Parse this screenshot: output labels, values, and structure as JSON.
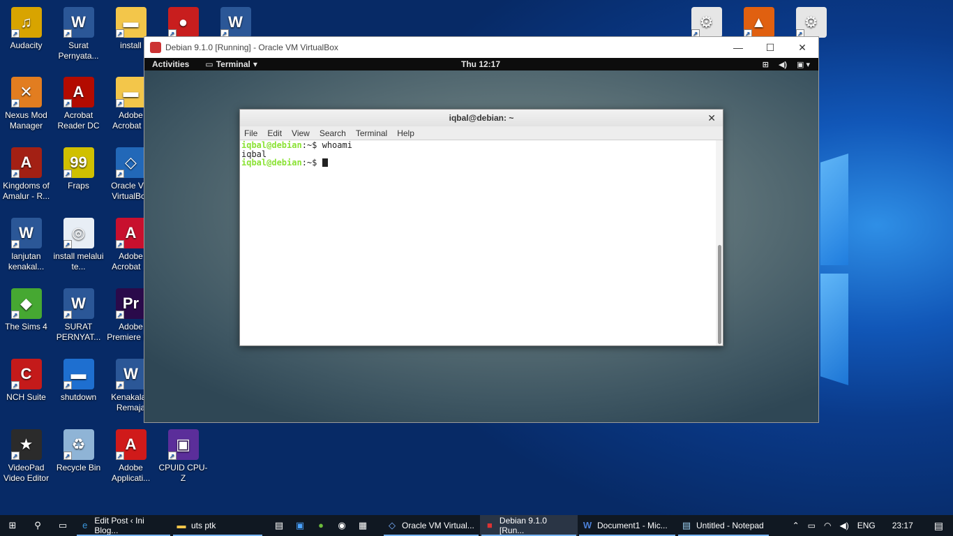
{
  "desktop_icons": [
    {
      "label": "Audacity",
      "glyph": "♫",
      "color": "#d8a400"
    },
    {
      "label": "Surat Pernyata...",
      "glyph": "W",
      "color": "#2b5797"
    },
    {
      "label": "install",
      "glyph": "▬",
      "color": "#f3c64a"
    },
    {
      "label": "",
      "glyph": "●",
      "color": "#c81e1e"
    },
    {
      "label": "",
      "glyph": "W",
      "color": "#2b5797"
    },
    {
      "label": "Nexus Mod Manager",
      "glyph": "✕",
      "color": "#e27d20"
    },
    {
      "label": "Acrobat Reader DC",
      "glyph": "A",
      "color": "#b30b00"
    },
    {
      "label": "Adobe Acrobat X",
      "glyph": "▬",
      "color": "#f3c64a"
    },
    {
      "label": "Kingdoms of Amalur - R...",
      "glyph": "A",
      "color": "#a32014"
    },
    {
      "label": "Fraps",
      "glyph": "99",
      "color": "#d0c000"
    },
    {
      "label": "Oracle VM VirtualBox",
      "glyph": "◇",
      "color": "#2268b8"
    },
    {
      "label": "lanjutan kenakal...",
      "glyph": "W",
      "color": "#2b5797"
    },
    {
      "label": "install melalui te...",
      "glyph": "◎",
      "color": "#e8eef5"
    },
    {
      "label": "Adobe Acrobat ...",
      "glyph": "A",
      "color": "#c8102e"
    },
    {
      "label": "The Sims 4",
      "glyph": "◆",
      "color": "#46a832"
    },
    {
      "label": "SURAT PERNYAT...",
      "glyph": "W",
      "color": "#2b5797"
    },
    {
      "label": "Adobe Premiere P...",
      "glyph": "Pr",
      "color": "#2a0a4a"
    },
    {
      "label": "NCH Suite",
      "glyph": "C",
      "color": "#c41a1a"
    },
    {
      "label": "shutdown",
      "glyph": "▬",
      "color": "#1e6fd0"
    },
    {
      "label": "Kenakalan Remaja",
      "glyph": "W",
      "color": "#2b5797"
    },
    {
      "label": "VideoPad Video Editor",
      "glyph": "★",
      "color": "#2b2b2b"
    },
    {
      "label": "Recycle Bin",
      "glyph": "♻",
      "color": "#8fb4d6"
    },
    {
      "label": "Adobe Applicati...",
      "glyph": "A",
      "color": "#d01a1a"
    },
    {
      "label": "CPUID CPU-Z",
      "glyph": "▣",
      "color": "#5b2e9a"
    },
    {
      "label": "",
      "glyph": "⚙",
      "color": "#e6e6e6"
    },
    {
      "label": "",
      "glyph": "▲",
      "color": "#e06010"
    },
    {
      "label": "",
      "glyph": "⚙",
      "color": "#e6e6e6"
    }
  ],
  "vbox": {
    "title": "Debian 9.1.0 [Running] - Oracle VM VirtualBox",
    "controls": [
      "—",
      "☐",
      "✕"
    ]
  },
  "gnome": {
    "activities": "Activities",
    "app_menu": "Terminal",
    "clock": "Thu 12:17"
  },
  "terminal": {
    "title": "iqbal@debian: ~",
    "menu": [
      "File",
      "Edit",
      "View",
      "Search",
      "Terminal",
      "Help"
    ],
    "lines": [
      {
        "prompt": "iqbal@debian",
        "rest": ":~$ whoami"
      },
      {
        "prompt": "",
        "rest": "iqbal"
      },
      {
        "prompt": "iqbal@debian",
        "rest": ":~$ "
      }
    ]
  },
  "taskbar": {
    "items": [
      {
        "label": "Edit Post ‹ Ini Blog...",
        "icon": "e"
      },
      {
        "label": "uts ptk",
        "icon": "▬"
      },
      {
        "label": "Oracle VM Virtual...",
        "icon": "◇"
      },
      {
        "label": "Debian 9.1.0 [Run...",
        "icon": "■"
      },
      {
        "label": "Document1 - Mic...",
        "icon": "W"
      },
      {
        "label": "Untitled - Notepad",
        "icon": "▤"
      }
    ],
    "language": "ENG",
    "time": "23:17"
  }
}
